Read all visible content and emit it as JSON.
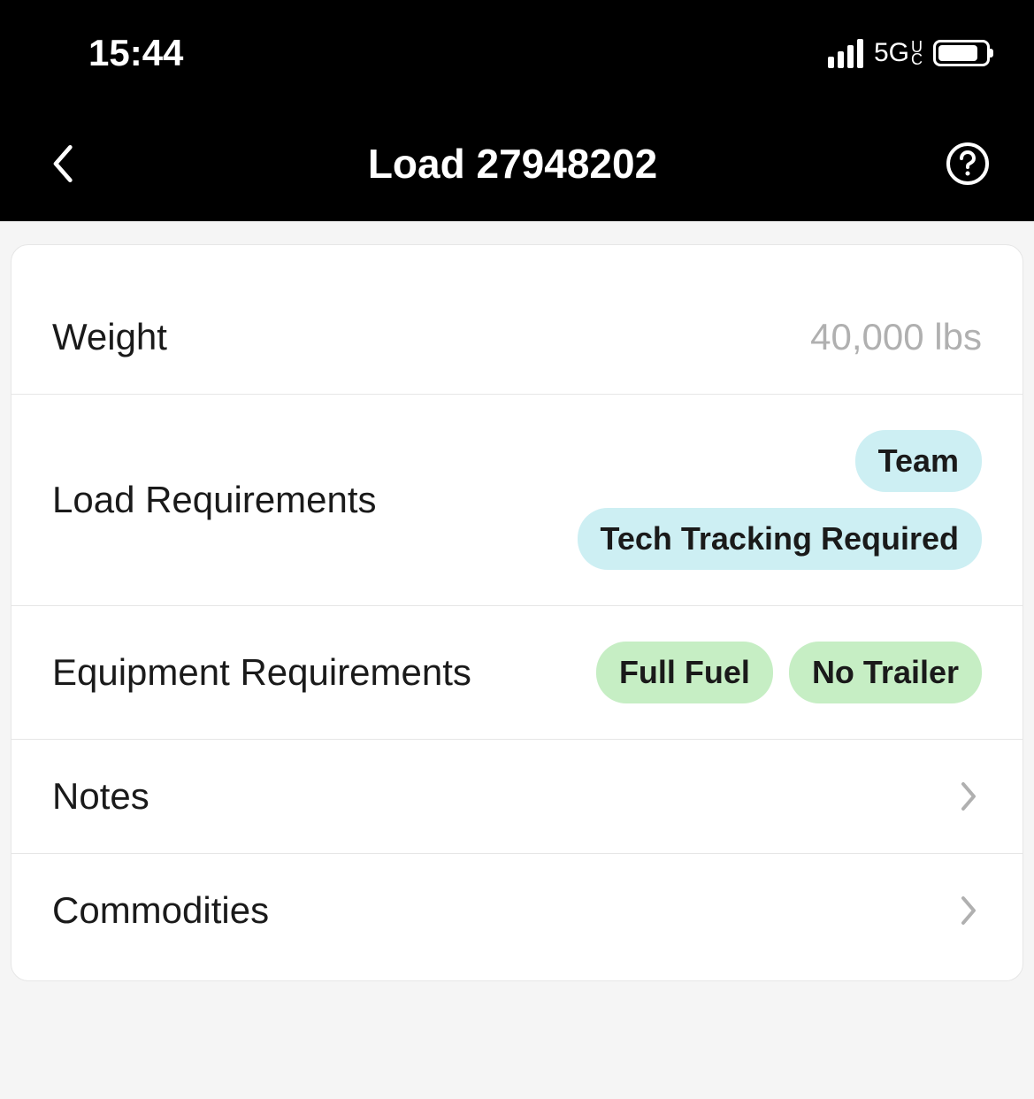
{
  "status": {
    "time": "15:44",
    "network": "5G",
    "network_sub_top": "U",
    "network_sub_bottom": "C"
  },
  "nav": {
    "title": "Load 27948202"
  },
  "rows": {
    "weight": {
      "label": "Weight",
      "value": "40,000 lbs"
    },
    "loadRequirements": {
      "label": "Load Requirements",
      "tags": [
        "Team",
        "Tech Tracking Required"
      ]
    },
    "equipmentRequirements": {
      "label": "Equipment Requirements",
      "tags": [
        "Full Fuel",
        "No Trailer"
      ]
    },
    "notes": {
      "label": "Notes"
    },
    "commodities": {
      "label": "Commodities"
    }
  }
}
